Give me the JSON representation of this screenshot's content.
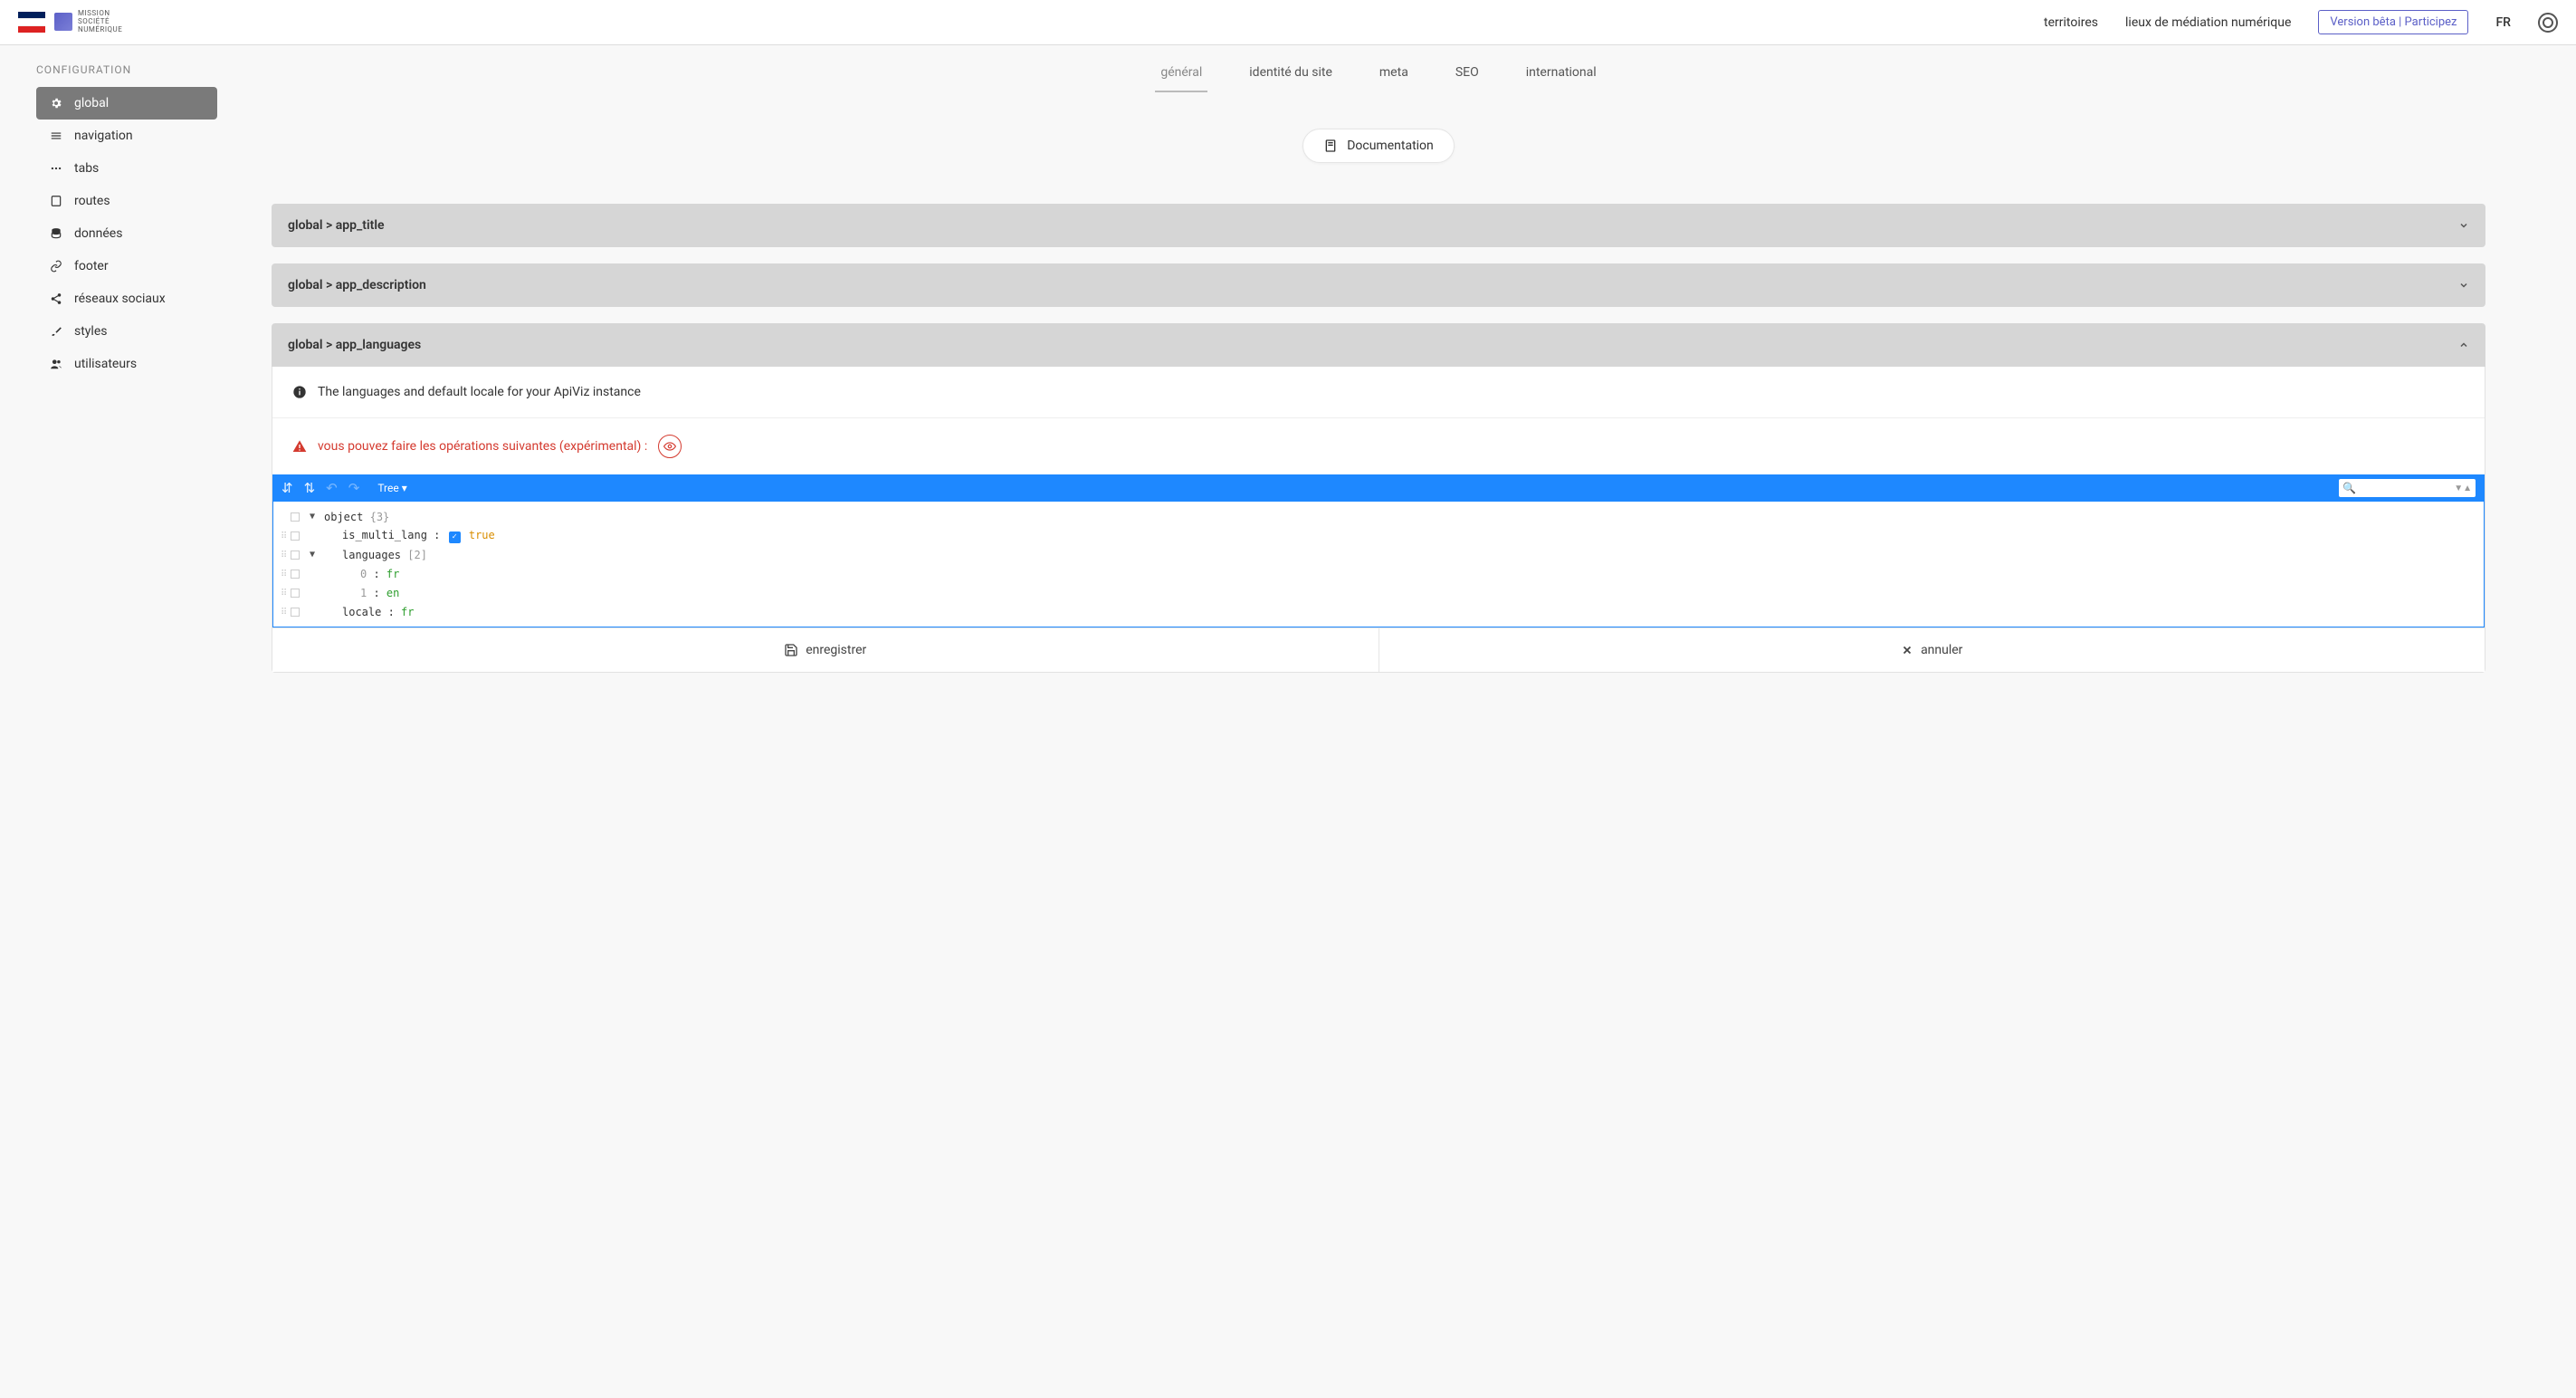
{
  "header": {
    "logo_text_1": "MISSION",
    "logo_text_2": "SOCIÉTÉ",
    "logo_text_3": "NUMÉRIQUE",
    "nav_territoires": "territoires",
    "nav_lieux": "lieux de médiation numérique",
    "beta_label": "Version bêta | Participez",
    "lang": "FR"
  },
  "sidebar": {
    "title": "CONFIGURATION",
    "items": [
      {
        "label": "global"
      },
      {
        "label": "navigation"
      },
      {
        "label": "tabs"
      },
      {
        "label": "routes"
      },
      {
        "label": "données"
      },
      {
        "label": "footer"
      },
      {
        "label": "réseaux sociaux"
      },
      {
        "label": "styles"
      },
      {
        "label": "utilisateurs"
      }
    ]
  },
  "tabs": [
    {
      "label": "général"
    },
    {
      "label": "identité du site"
    },
    {
      "label": "meta"
    },
    {
      "label": "SEO"
    },
    {
      "label": "international"
    }
  ],
  "documentation_label": "Documentation",
  "accordions": {
    "app_title": "global  > app_title",
    "app_description": "global  > app_description",
    "app_languages": {
      "title": "global  > app_languages",
      "info": "The languages and default locale for your ApiViz instance",
      "warning": "vous pouvez faire les opérations suivantes (expérimental) :"
    }
  },
  "json_editor": {
    "mode_label": "Tree",
    "root_label": "object",
    "root_meta": "{3}",
    "is_multi_lang_key": "is_multi_lang",
    "is_multi_lang_val": "true",
    "languages_key": "languages",
    "languages_meta": "[2]",
    "lang0_key": "0",
    "lang0_val": "fr",
    "lang1_key": "1",
    "lang1_val": "en",
    "locale_key": "locale",
    "locale_val": "fr"
  },
  "actions": {
    "save": "enregistrer",
    "cancel": "annuler"
  }
}
